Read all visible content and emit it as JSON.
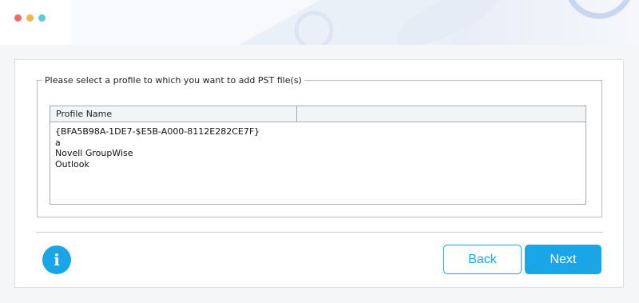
{
  "window": {
    "controls": [
      {
        "name": "close",
        "color": "#f06a6a"
      },
      {
        "name": "minimize",
        "color": "#f3b54a"
      },
      {
        "name": "maximize",
        "color": "#5cc9d9"
      }
    ]
  },
  "profile_group": {
    "legend": "Please select a profile to which you want to add PST file(s)",
    "columns": [
      "Profile Name",
      ""
    ],
    "rows": [
      "{BFA5B98A-1DE7-$E5B-A000-8112E282CE7F}",
      "a",
      "Novell GroupWise",
      "Outlook"
    ]
  },
  "footer": {
    "info_icon": "i",
    "back_label": "Back",
    "next_label": "Next"
  },
  "colors": {
    "accent": "#1aa5e6"
  }
}
